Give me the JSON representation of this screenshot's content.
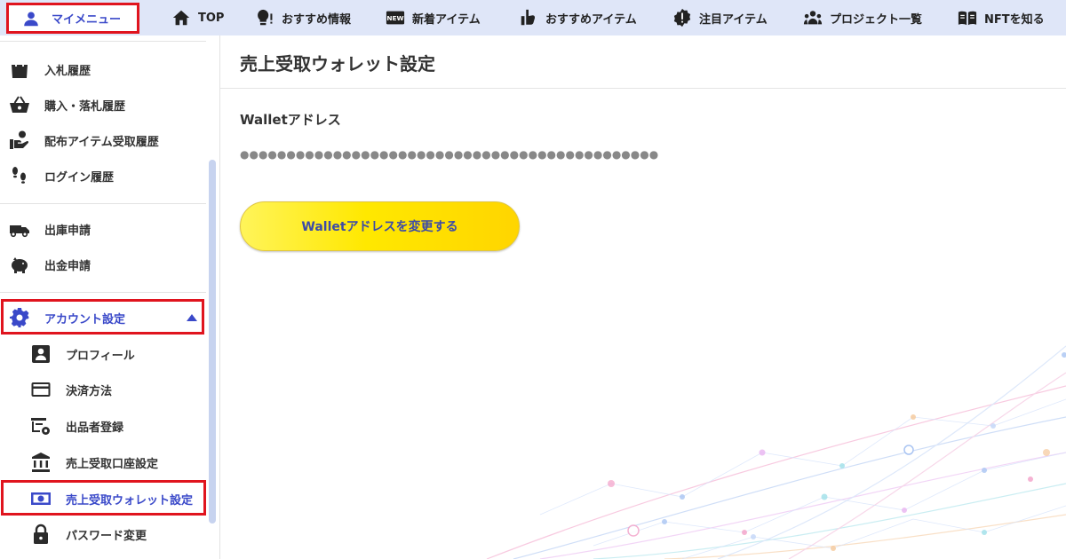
{
  "header": {
    "my_menu": {
      "label": "マイメニュー",
      "icon": "person-icon"
    },
    "nav": [
      {
        "label": "TOP",
        "icon": "home-icon"
      },
      {
        "label": "おすすめ情報",
        "icon": "lightbulb-icon"
      },
      {
        "label": "新着アイテム",
        "icon": "new-badge-icon"
      },
      {
        "label": "おすすめアイテム",
        "icon": "thumb-up-icon"
      },
      {
        "label": "注目アイテム",
        "icon": "alert-badge-icon"
      },
      {
        "label": "プロジェクト一覧",
        "icon": "group-icon"
      },
      {
        "label": "NFTを知る",
        "icon": "book-icon"
      }
    ]
  },
  "sidebar": {
    "history": [
      {
        "label": "入札履歴",
        "icon": "shopping-bag-icon"
      },
      {
        "label": "購入・落札履歴",
        "icon": "basket-icon"
      },
      {
        "label": "配布アイテム受取履歴",
        "icon": "hand-receive-icon"
      },
      {
        "label": "ログイン履歴",
        "icon": "footprints-icon"
      }
    ],
    "requests": [
      {
        "label": "出庫申請",
        "icon": "truck-icon"
      },
      {
        "label": "出金申請",
        "icon": "piggy-bank-icon"
      }
    ],
    "account": {
      "label": "アカウント設定",
      "icon": "gear-icon",
      "expanded_icon": "caret-up-icon",
      "items": [
        {
          "label": "プロフィール",
          "icon": "profile-card-icon"
        },
        {
          "label": "決済方法",
          "icon": "credit-card-icon"
        },
        {
          "label": "出品者登録",
          "icon": "register-settings-icon"
        },
        {
          "label": "売上受取口座設定",
          "icon": "bank-icon"
        },
        {
          "label": "売上受取ウォレット設定",
          "icon": "wallet-cash-icon"
        },
        {
          "label": "パスワード変更",
          "icon": "lock-icon"
        }
      ]
    }
  },
  "main": {
    "title": "売上受取ウォレット設定",
    "wallet_label": "Walletアドレス",
    "wallet_value": "●●●●●●●●●●●●●●●●●●●●●●●●●●●●●●●●●●●●●●●●●●●●●",
    "change_button": "Walletアドレスを変更する"
  },
  "colors": {
    "accent_blue": "#3a49c9",
    "highlight_red": "#e0141e",
    "topbar_bg": "#dfe6f8",
    "button_yellow": "#ffe800",
    "icon_dark": "#2b2b2b"
  }
}
